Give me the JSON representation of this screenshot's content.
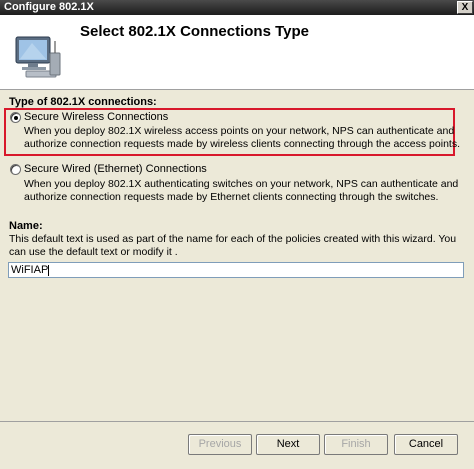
{
  "window": {
    "title": "Configure 802.1X",
    "close_label": "X"
  },
  "header": {
    "title": "Select 802.1X Connections Type",
    "icon": "wireless-computer-icon"
  },
  "connection_type": {
    "label": "Type of 802.1X connections:",
    "selected": "wireless",
    "options": [
      {
        "id": "wireless",
        "label": "Secure Wireless Connections",
        "description": "When you deploy 802.1X wireless access points on your network, NPS can authenticate and authorize connection requests made by wireless clients connecting through the access points.",
        "checked": true
      },
      {
        "id": "wired",
        "label": "Secure Wired (Ethernet) Connections",
        "description": "When you deploy 802.1X authenticating switches on your network, NPS can authenticate and authorize connection requests made by Ethernet clients connecting through the switches.",
        "checked": false
      }
    ]
  },
  "name_section": {
    "label": "Name:",
    "help": "This default text is used as part of the name for each of the policies created with this wizard. You can use the default text or modify it .",
    "value": "WiFIAP"
  },
  "buttons": {
    "previous": "Previous",
    "next": "Next",
    "finish": "Finish",
    "cancel": "Cancel"
  },
  "colors": {
    "highlight": "#d8182b",
    "header_bg": "#ffffff",
    "dialog_bg": "#ece9d8"
  }
}
